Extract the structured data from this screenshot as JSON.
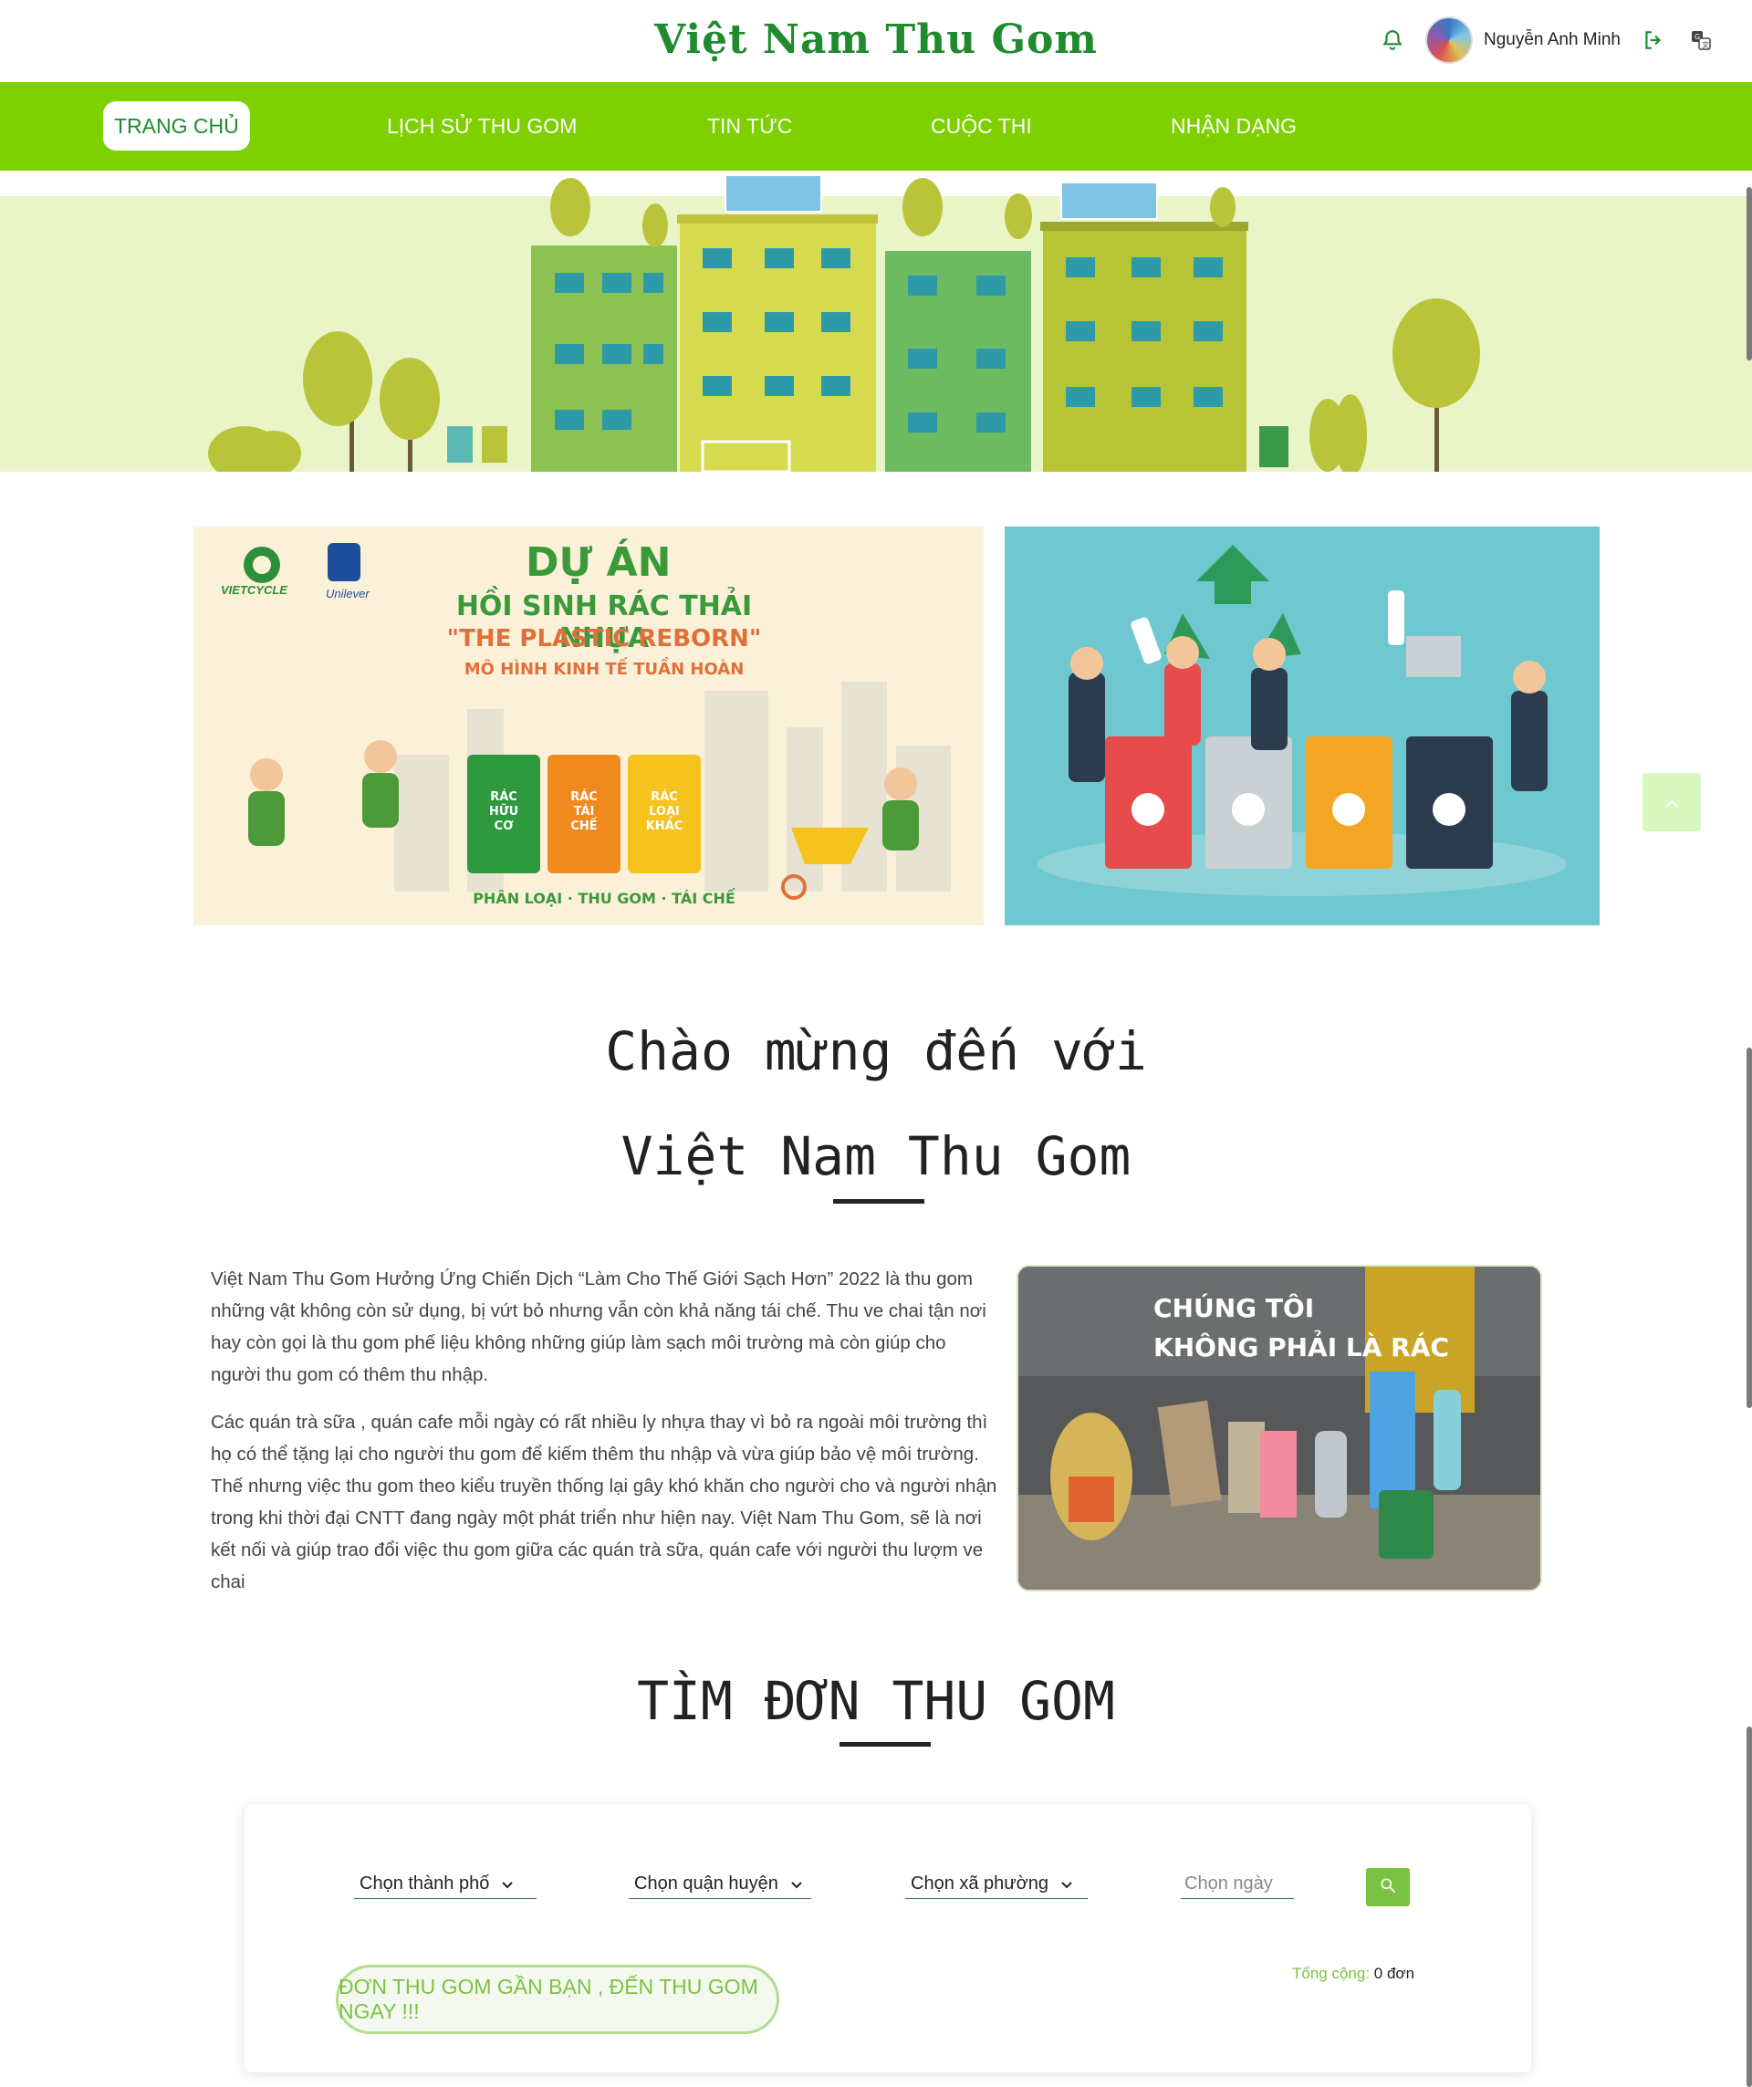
{
  "header": {
    "brand": "Việt Nam Thu Gom",
    "user_name": "Nguyễn Anh Minh"
  },
  "nav": {
    "items": [
      {
        "label": "TRANG CHỦ",
        "active": true
      },
      {
        "label": "LỊCH SỬ THU GOM",
        "active": false
      },
      {
        "label": "TIN TỨC",
        "active": false
      },
      {
        "label": "CUỘC THI",
        "active": false
      },
      {
        "label": "NHẬN DẠNG",
        "active": false
      }
    ]
  },
  "banner_left": {
    "logo1": "VIETCYCLE",
    "logo2": "Unilever",
    "title1": "DỰ ÁN",
    "title2": "HỒI SINH RÁC THẢI NHỰA",
    "title3": "\"THE PLASTIC REBORN\"",
    "title4": "MÔ HÌNH KINH TẾ TUẦN HOÀN",
    "bins": [
      "RÁC HỮU CƠ",
      "RÁC TÁI CHẾ",
      "RÁC LOẠI KHÁC"
    ],
    "footer": "PHÂN LOẠI · THU GOM · TÁI CHẾ"
  },
  "welcome": {
    "line1": "Chào mừng đến với",
    "line2": "Việt Nam Thu Gom"
  },
  "about": {
    "para1": "Việt Nam Thu Gom Hưởng Ứng Chiến Dịch “Làm Cho Thế Giới Sạch Hơn” 2022 là thu gom những vật không còn sử dụng, bị vứt bỏ nhưng vẫn còn khả năng tái chế. Thu ve chai tận nơi hay còn gọi là thu gom phế liệu không những giúp làm sạch môi trường mà còn giúp cho người thu gom có thêm thu nhập.",
    "para2": "Các quán trà sữa , quán cafe mỗi ngày có rất nhiều ly nhựa thay vì bỏ ra ngoài môi trường thì họ có thể tặng lại cho người thu gom để kiếm thêm thu nhập và vừa giúp bảo vệ môi trường. Thế nhưng việc thu gom theo kiểu truyền thống lại gây khó khăn cho người cho và người nhận trong khi thời đại CNTT đang ngày một phát triển như hiện nay. Việt Nam Thu Gom, sẽ là nơi kết nối và giúp trao đổi việc thu gom giữa các quán trà sữa, quán cafe với người thu lượm ve chai",
    "image_caption": "CHÚNG TÔI KHÔNG PHẢI LÀ RÁC"
  },
  "search": {
    "title": "TÌM ĐƠN THU GOM",
    "city": "Chọn thành phố",
    "district": "Chọn quận huyện",
    "ward": "Chọn xã phường",
    "date_placeholder": "Chọn ngày",
    "total_label": "Tổng cộng:",
    "total_value": "0 đơn",
    "nearby_button": "ĐƠN THU GOM GẦN BẠN , ĐẾN THU GOM NGAY !!!"
  },
  "colors": {
    "nav_bg": "#7ed000",
    "brand": "#1f8a2e",
    "accent": "#7cc242"
  },
  "icons": [
    "bell-icon",
    "avatar",
    "logout-icon",
    "translate-icon",
    "search-icon",
    "chevron-down-icon",
    "arrow-up-icon"
  ]
}
